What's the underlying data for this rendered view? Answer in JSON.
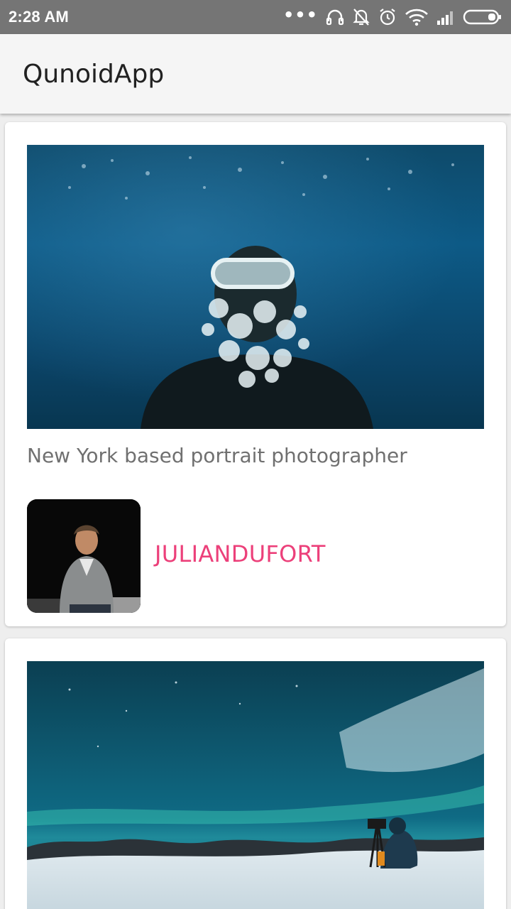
{
  "status_bar": {
    "time": "2:28 AM",
    "icons": [
      "more-dots-icon",
      "headphones-icon",
      "bell-off-icon",
      "alarm-icon",
      "wifi-icon",
      "signal-icon",
      "battery-icon"
    ]
  },
  "app_bar": {
    "title": "QunoidApp"
  },
  "feed": {
    "cards": [
      {
        "photo_icon": "underwater-diver-photo",
        "description": "New York based portrait photographer",
        "author": {
          "avatar_icon": "author-avatar-photo",
          "name": "JULIANDUFORT"
        }
      },
      {
        "photo_icon": "aurora-landscape-photo"
      }
    ]
  },
  "colors": {
    "status_bar": "#757575",
    "app_bar": "#f5f5f5",
    "background": "#eeeeee",
    "card": "#ffffff",
    "description_text": "#707070",
    "author_accent": "#ec407a"
  }
}
